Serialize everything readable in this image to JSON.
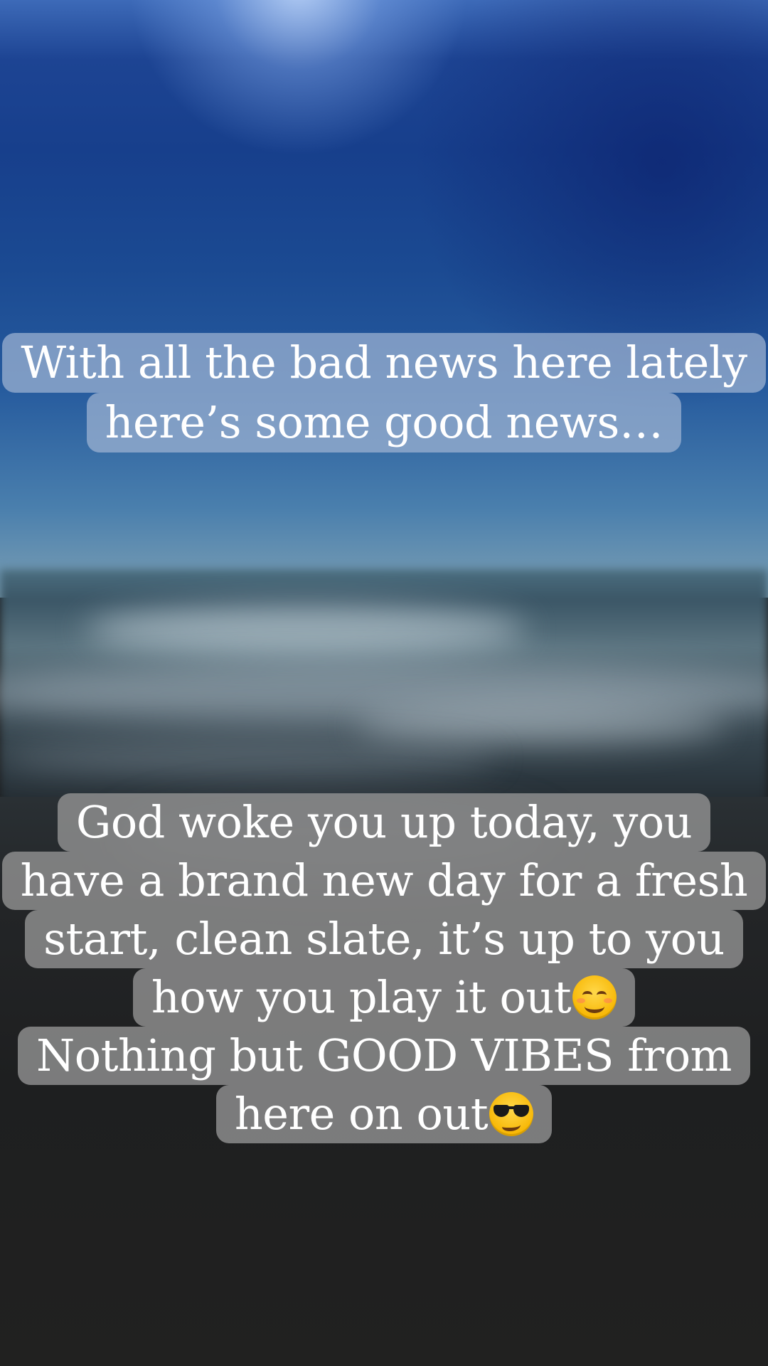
{
  "story": {
    "top_caption": {
      "lines": [
        "With all the bad news here lately",
        "here’s some good news…"
      ]
    },
    "bottom_caption": {
      "lines": [
        "God woke you up today, you",
        "have a brand new day for a fresh",
        "start, clean slate, it’s up to you",
        "how you play it out",
        "Nothing but GOOD VIBES from",
        "here on out"
      ],
      "emojis": {
        "line_4": "smiling-face-icon",
        "line_6": "sunglasses-face-icon"
      }
    }
  }
}
